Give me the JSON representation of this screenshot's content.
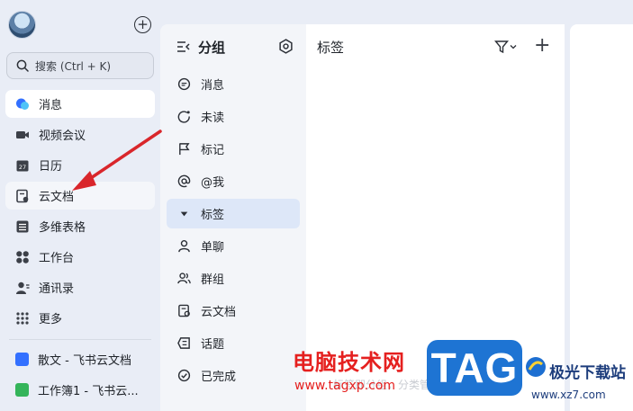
{
  "sidebar": {
    "search_placeholder": "搜索 (Ctrl + K)",
    "items": [
      {
        "label": "消息",
        "icon": "chat-bubble-icon"
      },
      {
        "label": "视频会议",
        "icon": "video-camera-icon"
      },
      {
        "label": "日历",
        "icon": "calendar-icon"
      },
      {
        "label": "云文档",
        "icon": "cloud-doc-icon"
      },
      {
        "label": "多维表格",
        "icon": "table-icon"
      },
      {
        "label": "工作台",
        "icon": "apps-grid-icon"
      },
      {
        "label": "通讯录",
        "icon": "contacts-icon"
      },
      {
        "label": "更多",
        "icon": "dots-grid-icon"
      }
    ],
    "recent_docs": [
      {
        "label": "散文 - 飞书云文档",
        "color": "#3370ff"
      },
      {
        "label": "工作簿1 - 飞书云...",
        "color": "#34b45a"
      }
    ],
    "calendar_day": "27"
  },
  "groups": {
    "title": "分组",
    "items": [
      {
        "label": "消息",
        "icon": "message-icon"
      },
      {
        "label": "未读",
        "icon": "unread-icon"
      },
      {
        "label": "标记",
        "icon": "flag-icon"
      },
      {
        "label": "@我",
        "icon": "at-icon"
      },
      {
        "label": "标签",
        "icon": "caret-down-icon"
      },
      {
        "label": "单聊",
        "icon": "person-icon"
      },
      {
        "label": "群组",
        "icon": "group-icon"
      },
      {
        "label": "云文档",
        "icon": "cloud-doc-icon"
      },
      {
        "label": "话题",
        "icon": "topic-icon"
      },
      {
        "label": "已完成",
        "icon": "check-circle-icon"
      }
    ]
  },
  "content": {
    "title": "标签",
    "hint": "标签即分组，分类管理更安心"
  },
  "watermark": {
    "site_cn": "电脑技术网",
    "url": "www.tagxp.com",
    "tag": "TAG",
    "site2": "极光下载站",
    "site2_url": "www.xz7.com"
  },
  "colors": {
    "accent": "#3370ff",
    "active_bg": "#dde7f8",
    "arrow": "#d9262b"
  }
}
